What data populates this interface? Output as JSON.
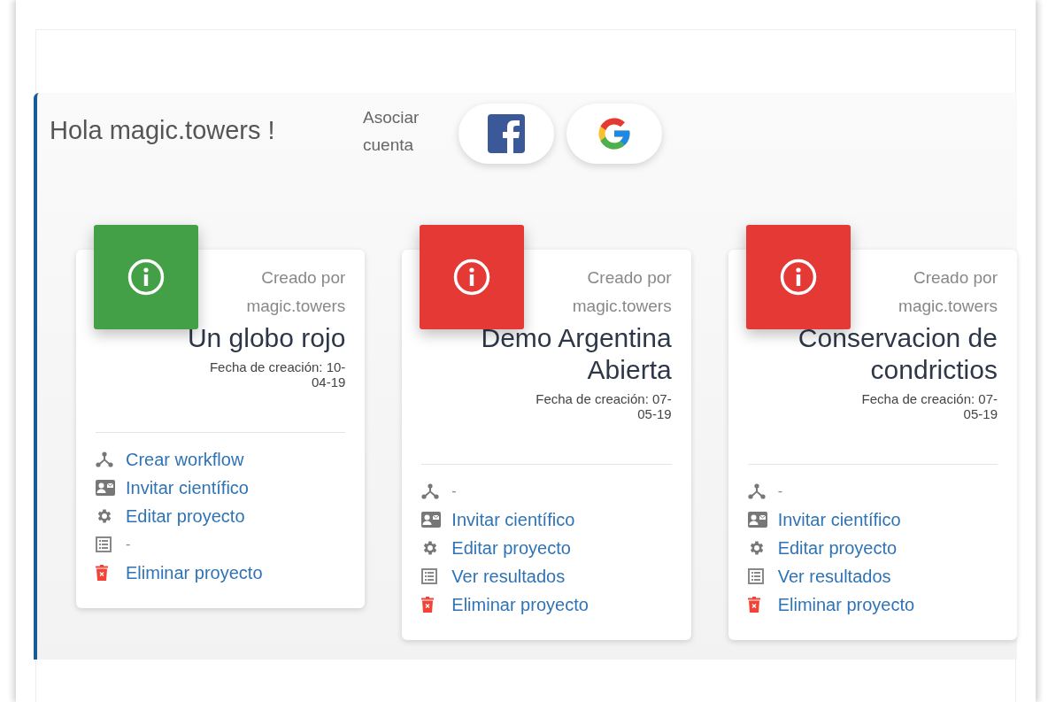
{
  "greeting": "Hola magic.towers !",
  "link_account": {
    "label": "Asociar cuenta",
    "providers": [
      {
        "kind": "facebook"
      },
      {
        "kind": "google"
      }
    ]
  },
  "projects": [
    {
      "color": "#43a047",
      "created_by_label": "Creado por",
      "author": "magic.towers",
      "title": "Un globo rojo",
      "date": "Fecha de creación: 10-04-19",
      "actions": [
        {
          "kind": "workflow",
          "label": "Crear workflow",
          "disabled": false
        },
        {
          "kind": "invite",
          "label": "Invitar científico",
          "disabled": false
        },
        {
          "kind": "edit",
          "label": "Editar proyecto",
          "disabled": false
        },
        {
          "kind": "results",
          "label": "-",
          "disabled": true
        },
        {
          "kind": "delete",
          "label": "Eliminar proyecto",
          "disabled": false
        }
      ]
    },
    {
      "color": "#e53935",
      "created_by_label": "Creado por",
      "author": "magic.towers",
      "title": "Demo Argentina Abierta",
      "date": "Fecha de creación: 07-05-19",
      "actions": [
        {
          "kind": "workflow",
          "label": "-",
          "disabled": true
        },
        {
          "kind": "invite",
          "label": "Invitar científico",
          "disabled": false
        },
        {
          "kind": "edit",
          "label": "Editar proyecto",
          "disabled": false
        },
        {
          "kind": "results",
          "label": "Ver resultados",
          "disabled": false
        },
        {
          "kind": "delete",
          "label": "Eliminar proyecto",
          "disabled": false
        }
      ]
    },
    {
      "color": "#e53935",
      "created_by_label": "Creado por",
      "author": "magic.towers",
      "title": "Conservacion de condrictios",
      "date": "Fecha de creación: 07-05-19",
      "actions": [
        {
          "kind": "workflow",
          "label": "-",
          "disabled": true
        },
        {
          "kind": "invite",
          "label": "Invitar científico",
          "disabled": false
        },
        {
          "kind": "edit",
          "label": "Editar proyecto",
          "disabled": false
        },
        {
          "kind": "results",
          "label": "Ver resultados",
          "disabled": false
        },
        {
          "kind": "delete",
          "label": "Eliminar proyecto",
          "disabled": false
        }
      ]
    }
  ]
}
